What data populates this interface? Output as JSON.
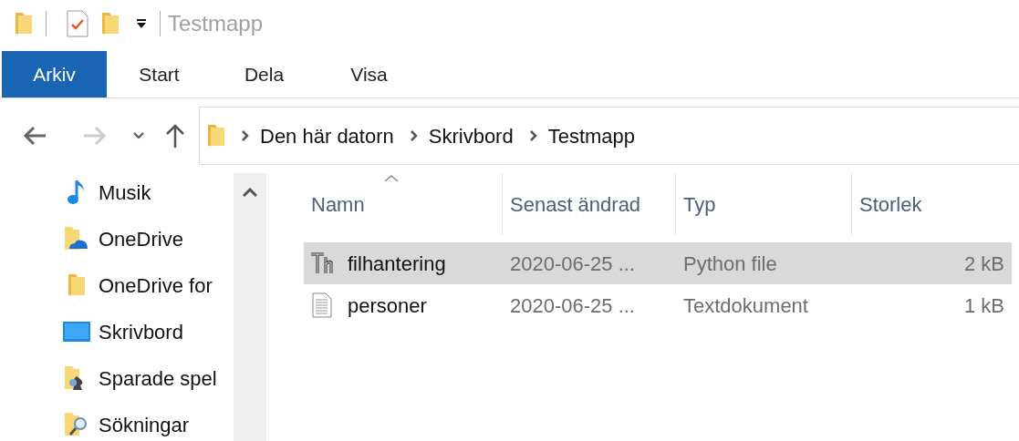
{
  "window": {
    "title": "Testmapp"
  },
  "ribbon_tabs": [
    {
      "label": "Arkiv",
      "selected": true
    },
    {
      "label": "Start",
      "selected": false
    },
    {
      "label": "Dela",
      "selected": false
    },
    {
      "label": "Visa",
      "selected": false
    }
  ],
  "navigation": {
    "back_disabled": false,
    "forward_disabled": true
  },
  "breadcrumb": [
    "Den här datorn",
    "Skrivbord",
    "Testmapp"
  ],
  "sidebar": {
    "items": [
      {
        "label": "Musik",
        "kind": "music"
      },
      {
        "label": "OneDrive",
        "kind": "cloud"
      },
      {
        "label": "OneDrive for",
        "kind": "folder"
      },
      {
        "label": "Skrivbord",
        "kind": "desktop"
      },
      {
        "label": "Sparade spel",
        "kind": "games"
      },
      {
        "label": "Sökningar",
        "kind": "search"
      }
    ]
  },
  "table": {
    "columns": [
      {
        "label": "Namn",
        "sorted": true
      },
      {
        "label": "Senast ändrad",
        "sorted": false
      },
      {
        "label": "Typ",
        "sorted": false
      },
      {
        "label": "Storlek",
        "sorted": false
      }
    ],
    "rows": [
      {
        "kind": "python",
        "name": "filhantering",
        "modified": "2020-06-25 ...",
        "type": "Python file",
        "size": "2 kB",
        "selected": true
      },
      {
        "kind": "text",
        "name": "personer",
        "modified": "2020-06-25 ...",
        "type": "Textdokument",
        "size": "1 kB",
        "selected": false
      }
    ]
  }
}
